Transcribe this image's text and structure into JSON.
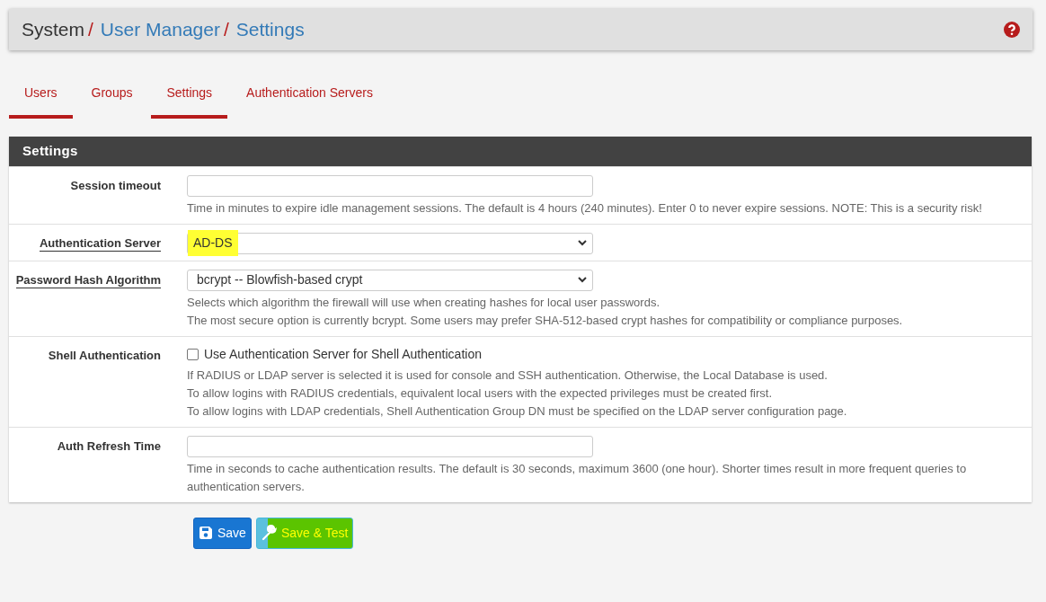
{
  "breadcrumb": [
    {
      "label": "System",
      "link": false
    },
    {
      "separator": "/",
      "label": "User Manager",
      "link": true
    },
    {
      "separator": "/",
      "label": "Settings",
      "link": true
    }
  ],
  "tabs": [
    {
      "label": "Users",
      "selected": true
    },
    {
      "label": "Groups",
      "selected": false
    },
    {
      "label": "Settings",
      "selected": true
    },
    {
      "label": "Authentication Servers",
      "selected": false
    }
  ],
  "panel": {
    "title": "Settings",
    "rows": [
      {
        "kind": "text",
        "label": "Session timeout",
        "label_link": false,
        "value": "",
        "help": [
          "Time in minutes to expire idle management sessions. The default is 4 hours (240 minutes). Enter 0 to never expire sessions. NOTE: This is a security risk!"
        ]
      },
      {
        "kind": "select",
        "label": "Authentication Server",
        "label_link": true,
        "value": "AD-DS",
        "highlighted": true,
        "help": []
      },
      {
        "kind": "select",
        "label": "Password Hash Algorithm",
        "label_link": true,
        "value": "bcrypt -- Blowfish-based crypt",
        "highlighted": false,
        "help": [
          "Selects which algorithm the firewall will use when creating hashes for local user passwords.",
          "The most secure option is currently bcrypt. Some users may prefer SHA-512-based crypt hashes for compatibility or compliance purposes."
        ]
      },
      {
        "kind": "checkbox",
        "label": "Shell Authentication",
        "label_link": false,
        "text": "Use Authentication Server for Shell Authentication",
        "checked": false,
        "help": [
          "If RADIUS or LDAP server is selected it is used for console and SSH authentication. Otherwise, the Local Database is used.",
          "To allow logins with RADIUS credentials, equivalent local users with the expected privileges must be created first.",
          "To allow logins with LDAP credentials, Shell Authentication Group DN must be specified on the LDAP server configuration page."
        ]
      },
      {
        "kind": "text",
        "label": "Auth Refresh Time",
        "label_link": false,
        "value": "",
        "help": [
          "Time in seconds to cache authentication results. The default is 30 seconds, maximum 3600 (one hour). Shorter times result in more frequent queries to authentication servers."
        ]
      }
    ]
  },
  "buttons": [
    {
      "kind": "save",
      "label": "Save",
      "highlighted": false
    },
    {
      "kind": "test",
      "label": "Save & Test",
      "highlighted": true
    }
  ]
}
